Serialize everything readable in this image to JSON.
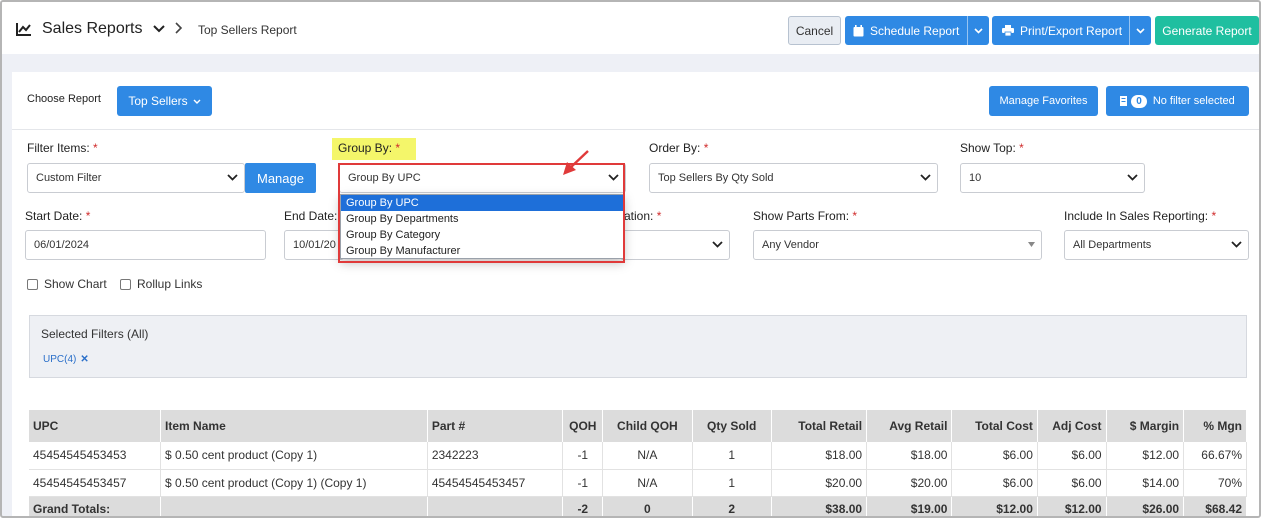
{
  "header": {
    "title": "Sales Reports",
    "breadcrumb": "Top Sellers Report",
    "cancel_label": "Cancel",
    "schedule_label": "Schedule Report",
    "print_label": "Print/Export Report",
    "generate_label": "Generate Report"
  },
  "toolbar": {
    "choose_report_label": "Choose Report",
    "report_value": "Top Sellers",
    "manage_favorites_label": "Manage Favorites",
    "filter_count": "0",
    "filter_status": "No filter selected"
  },
  "form": {
    "filter_items_label": "Filter Items:",
    "filter_items_value": "Custom Filter",
    "manage_label": "Manage",
    "group_by_label": "Group By:",
    "group_by_value": "Group By UPC",
    "group_by_options": [
      "Group By UPC",
      "Group By Departments",
      "Group By Category",
      "Group By Manufacturer"
    ],
    "order_by_label": "Order By:",
    "order_by_value": "Top Sellers By Qty Sold",
    "show_top_label": "Show Top:",
    "show_top_value": "10",
    "start_date_label": "Start Date:",
    "start_date_value": "06/01/2024",
    "end_date_label": "End Date:",
    "end_date_value": "10/01/20",
    "location_label_partial": "ation:",
    "show_parts_label": "Show Parts From:",
    "show_parts_value": "Any Vendor",
    "include_label": "Include In Sales Reporting:",
    "include_value": "All Departments",
    "required_mark": "*",
    "show_chart_label": "Show Chart",
    "rollup_links_label": "Rollup Links"
  },
  "selected_filters": {
    "title": "Selected Filters (All)",
    "chip": "UPC(4)",
    "remove_glyph": "✕"
  },
  "table": {
    "headers": [
      "UPC",
      "Item Name",
      "Part #",
      "QOH",
      "Child QOH",
      "Qty Sold",
      "Total Retail",
      "Avg Retail",
      "Total Cost",
      "Adj Cost",
      "$ Margin",
      "% Mgn"
    ],
    "rows": [
      [
        "45454545453453",
        "$ 0.50 cent product (Copy 1)",
        "2342223",
        "-1",
        "N/A",
        "1",
        "$18.00",
        "$18.00",
        "$6.00",
        "$6.00",
        "$12.00",
        "66.67%"
      ],
      [
        "45454545453457",
        "$ 0.50 cent product (Copy 1) (Copy 1)",
        "45454545453457",
        "-1",
        "N/A",
        "1",
        "$20.00",
        "$20.00",
        "$6.00",
        "$6.00",
        "$14.00",
        "70%"
      ]
    ],
    "grand_totals": [
      "Grand Totals:",
      "",
      "",
      "-2",
      "0",
      "2",
      "$38.00",
      "$19.00",
      "$12.00",
      "$12.00",
      "$26.00",
      "$68.42"
    ]
  },
  "colors": {
    "primary": "#2f89e4",
    "accent": "#1fbfa0",
    "annotation": "#e03a3a",
    "highlight": "#f4f66a"
  }
}
